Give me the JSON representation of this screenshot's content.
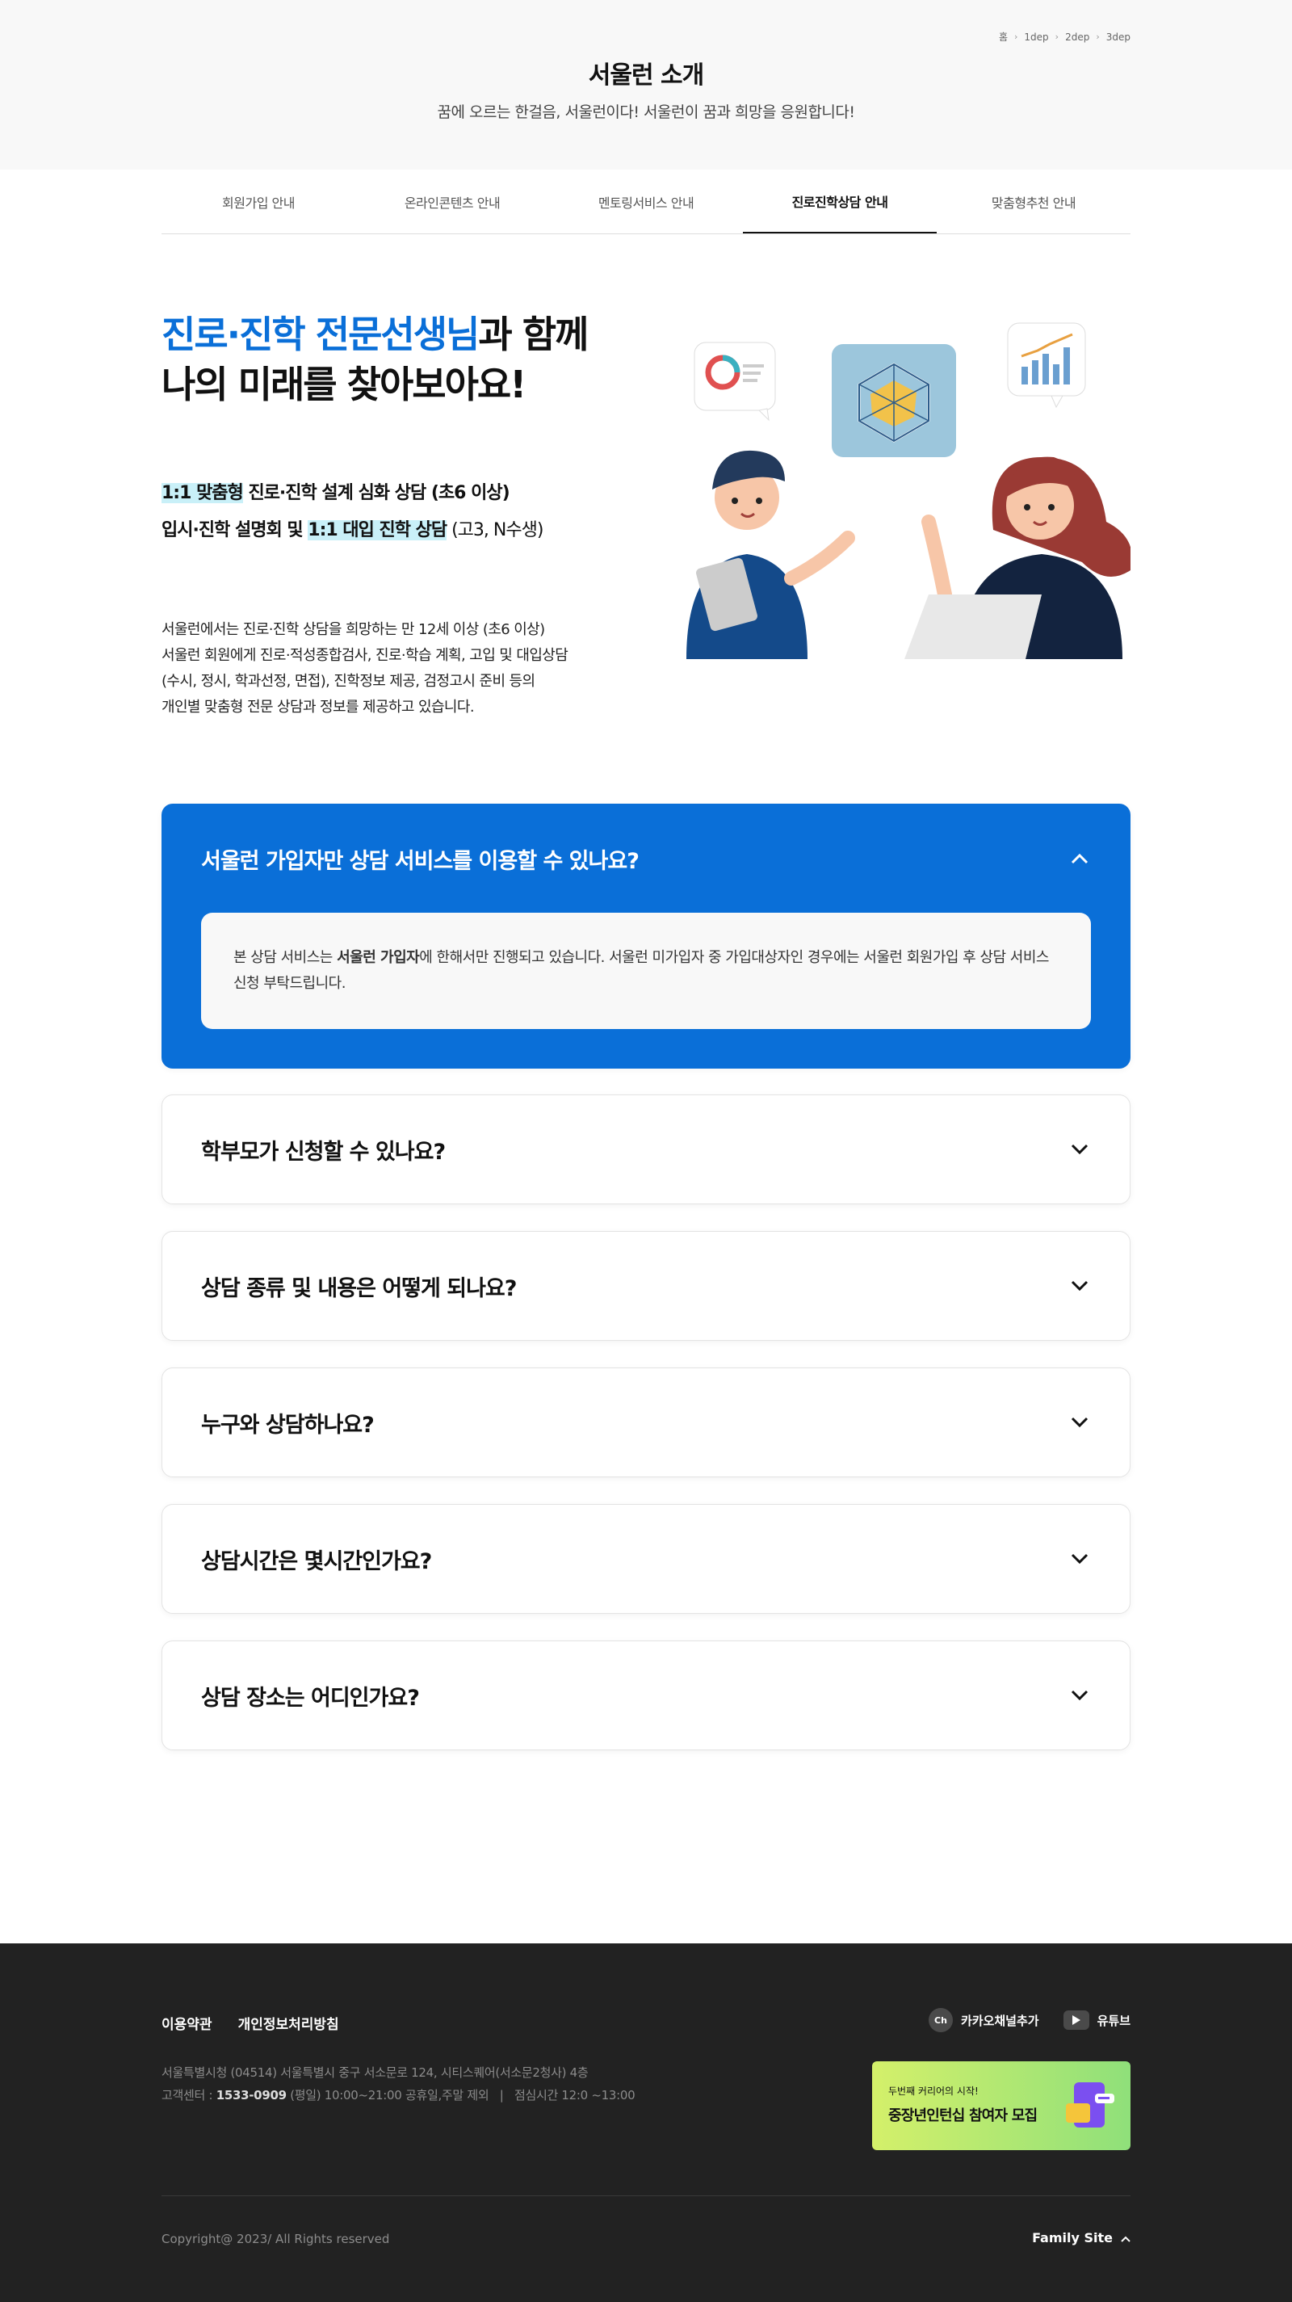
{
  "breadcrumb": [
    "홈",
    "1dep",
    "2dep",
    "3dep"
  ],
  "header": {
    "title": "서울런 소개",
    "subtitle": "꿈에 오르는 한걸음, 서울런이다! 서울런이 꿈과 희망을 응원합니다!"
  },
  "tabs": [
    {
      "label": "회원가입 안내",
      "active": false
    },
    {
      "label": "온라인콘텐츠 안내",
      "active": false
    },
    {
      "label": "멘토링서비스 안내",
      "active": false
    },
    {
      "label": "진로진학상담 안내",
      "active": true
    },
    {
      "label": "맞춤형추천 안내",
      "active": false
    }
  ],
  "intro": {
    "headline_blue": "진로·진학 전문선생님",
    "headline_rest": "과 함께",
    "headline_line2": "나의 미래를 찾아보아요!",
    "point1_hl": "1:1 맞춤형",
    "point1_rest": " 진로·진학 설계 심화 상담 (초6 이상)",
    "point2_pre": "입시·진학 설명회 및 ",
    "point2_hl": "1:1 대입 진학 상담",
    "point2_post": " (고3, N수생)",
    "desc": [
      "서울런에서는 진로·진학 상담을 희망하는 만 12세 이상 (초6 이상)",
      "서울런 회원에게 진로·적성종합검사, 진로·학습 계획, 고입 및 대입상담",
      "(수시, 정시, 학과선정, 면접), 진학정보 제공, 검정고시 준비 등의",
      "개인별 맞춤형 전문 상담과 정보를 제공하고 있습니다."
    ]
  },
  "faq": {
    "open": {
      "question": "서울런 가입자만 상담 서비스를 이용할 수 있나요?",
      "answer_pre": "본 상담 서비스는 ",
      "answer_bold": "서울런 가입자",
      "answer_post": "에 한해서만 진행되고 있습니다. 서울런 미가입자 중 가입대상자인 경우에는 서울런 회원가입 후 상담 서비스 신청 부탁드립니다."
    },
    "items": [
      "학부모가 신청할 수 있나요?",
      "상담 종류 및 내용은 어떻게 되나요?",
      "누구와 상담하나요?",
      "상담시간은 몇시간인가요?",
      "상담 장소는 어디인가요?"
    ]
  },
  "footer": {
    "links": [
      "이용약관",
      "개인정보처리방침"
    ],
    "address": "서울특별시청 (04514) 서울특별시 중구 서소문로 124, 시티스퀘어(서소문2청사) 4층",
    "cs_label": "고객센터 : ",
    "cs_number": "1533-0909",
    "cs_hours": " (평일) 10:00~21:00 공휴일,주말 제외   |   점심시간 12:0 ~13:00",
    "kakao": "카카오채널추가",
    "kakao_icon": "Ch",
    "youtube": "유튜브",
    "banner_small": "두번째 커리어의 시작!",
    "banner_big": "중장년인턴십 참여자 모집",
    "copyright": "Copyright@ 2023/ All Rights reserved",
    "family": "Family Site"
  }
}
